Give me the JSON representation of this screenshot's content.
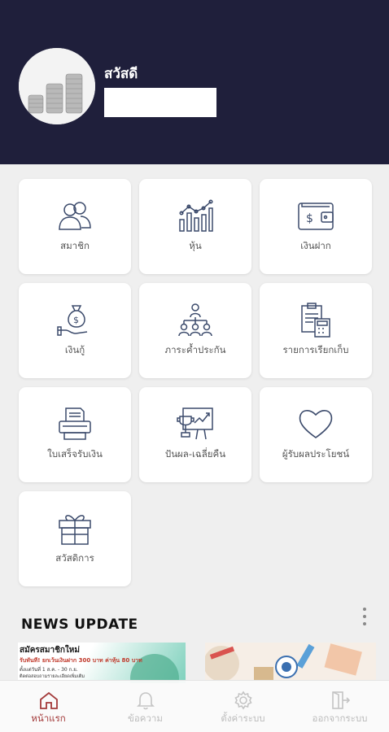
{
  "header": {
    "greeting": "สวัสดี",
    "username": ""
  },
  "menu": [
    {
      "label": "สมาชิก",
      "icon": "members-icon"
    },
    {
      "label": "หุ้น",
      "icon": "stock-chart-icon"
    },
    {
      "label": "เงินฝาก",
      "icon": "wallet-icon"
    },
    {
      "label": "เงินกู้",
      "icon": "loan-money-bag-icon"
    },
    {
      "label": "ภาระค้ำประกัน",
      "icon": "guarantor-hierarchy-icon"
    },
    {
      "label": "รายการเรียกเก็บ",
      "icon": "billing-calculator-icon"
    },
    {
      "label": "ใบเสร็จรับเงิน",
      "icon": "receipt-printer-icon"
    },
    {
      "label": "ปันผล-เฉลี่ยคืน",
      "icon": "dividend-trophy-icon"
    },
    {
      "label": "ผู้รับผลประโยชน์",
      "icon": "heart-icon"
    },
    {
      "label": "สวัสดิการ",
      "icon": "gift-icon"
    }
  ],
  "news": {
    "title": "NEWS UPDATE",
    "card1": {
      "headline": "สมัครสมาชิกใหม่",
      "line2": "รับทันที! ยกเว้นเงินฝาก 300 บาท ค่าหุ้น 80 บาท",
      "line3": "ตั้งแต่วันที่ 1 ส.ค. - 30 ก.ย.",
      "line4": "ติดต่อสอบถามรายละเอียดเพิ่มเติม"
    }
  },
  "tabs": [
    {
      "label": "หน้าแรก",
      "icon": "home-icon",
      "active": true
    },
    {
      "label": "ข้อความ",
      "icon": "bell-icon",
      "active": false
    },
    {
      "label": "ตั้งค่าระบบ",
      "icon": "gear-icon",
      "active": false
    },
    {
      "label": "ออกจากระบบ",
      "icon": "logout-icon",
      "active": false
    }
  ],
  "colors": {
    "header_bg": "#1f1f3b",
    "accent": "#a33a3a",
    "icon_stroke": "#3b4a6b"
  }
}
